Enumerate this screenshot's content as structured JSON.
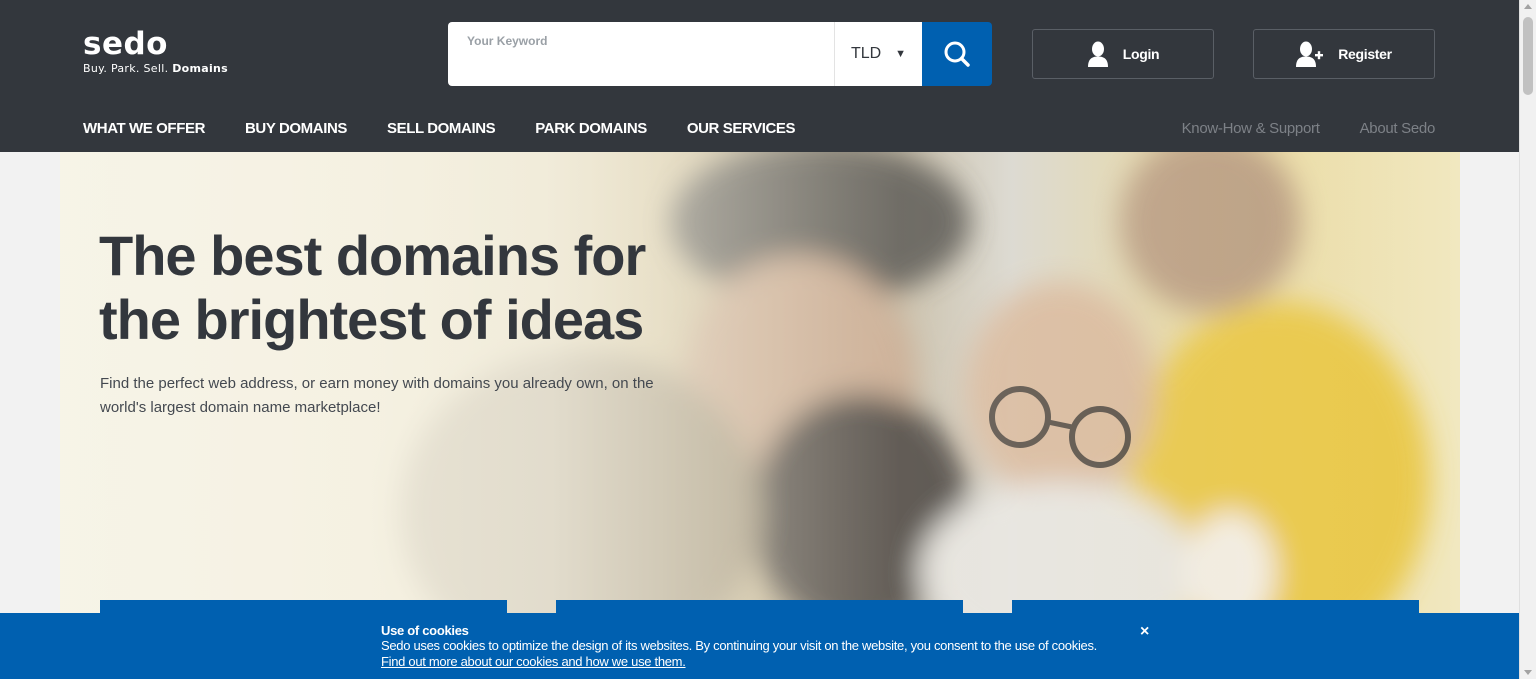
{
  "logo": {
    "name": "sedo",
    "tagline_prefix": "Buy. Park. Sell.",
    "tagline_bold": "Domains"
  },
  "search": {
    "placeholder": "Your Keyword",
    "value": "",
    "tld_label": "TLD",
    "button_icon": "search-icon"
  },
  "header_buttons": {
    "login": "Login",
    "register": "Register"
  },
  "main_nav": [
    "WHAT WE OFFER",
    "BUY DOMAINS",
    "SELL DOMAINS",
    "PARK DOMAINS",
    "OUR SERVICES"
  ],
  "sub_nav": [
    "Know-How & Support",
    "About Sedo"
  ],
  "hero": {
    "title": "The best domains for the brightest of ideas",
    "subtitle": "Find the perfect web address, or earn money with domains you already own, on the world's largest domain name marketplace!"
  },
  "cookie": {
    "title": "Use of cookies",
    "text": "Sedo uses cookies to optimize the design of its websites. By continuing your visit on the website, you consent to the use of cookies.",
    "link": "Find out more about our cookies and how we use them.",
    "close": "×"
  },
  "colors": {
    "header_bg": "#33373d",
    "brand_blue": "#0060b0",
    "muted_nav": "#7d8187"
  }
}
